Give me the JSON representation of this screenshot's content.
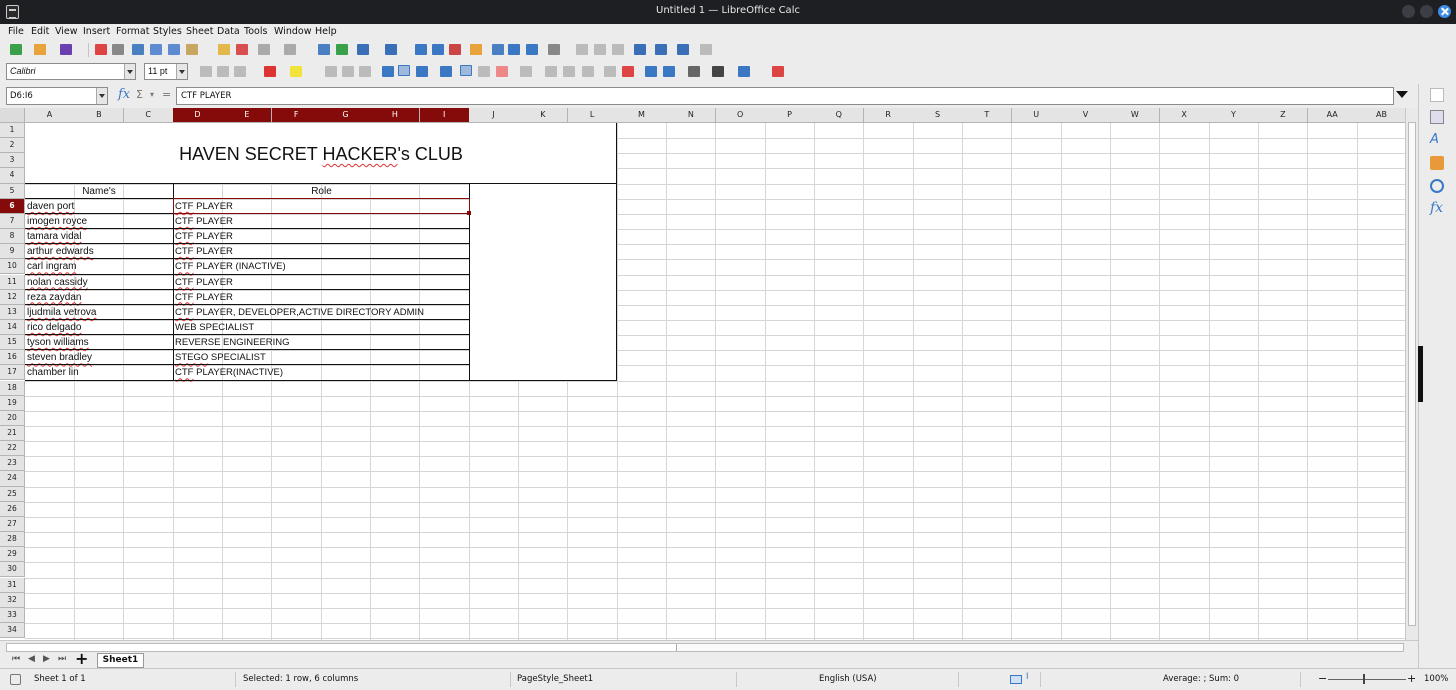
{
  "window": {
    "title": "Untitled 1 — LibreOffice Calc"
  },
  "menu": [
    "File",
    "Edit",
    "View",
    "Insert",
    "Format",
    "Styles",
    "Sheet",
    "Data",
    "Tools",
    "Window",
    "Help"
  ],
  "toolbar": {
    "font_name": "Calibri",
    "font_size": "11 pt"
  },
  "formula_bar": {
    "cell_ref": "D6:I6",
    "content": "CTF PLAYER",
    "function_wizard_icon": "fx",
    "sum_icon": "Σ",
    "equals_icon": "="
  },
  "columns": [
    "A",
    "B",
    "C",
    "D",
    "E",
    "F",
    "G",
    "H",
    "I",
    "J",
    "K",
    "L",
    "M",
    "N",
    "O",
    "P",
    "Q",
    "R",
    "S",
    "T",
    "U",
    "V",
    "W",
    "X",
    "Y",
    "Z",
    "AA",
    "AB"
  ],
  "selected_columns": [
    "D",
    "E",
    "F",
    "G",
    "H",
    "I"
  ],
  "rows": [
    "1",
    "2",
    "3",
    "4",
    "5",
    "6",
    "7",
    "8",
    "9",
    "10",
    "11",
    "12",
    "13",
    "14",
    "15",
    "16",
    "17",
    "18",
    "19",
    "20",
    "21",
    "22",
    "23",
    "24",
    "25",
    "26",
    "27",
    "28",
    "29",
    "30",
    "31",
    "32",
    "33",
    "34"
  ],
  "selected_row": "6",
  "sheet": {
    "title_prefix": "HAVEN SECRET ",
    "title_misspelled": "HACKER",
    "title_suffix": "'s CLUB",
    "header_names": "Name's",
    "header_role": "Role",
    "members": [
      {
        "name": "daven port",
        "role_prefix": "CTF",
        "role_rest": " PLAYER"
      },
      {
        "name": "imogen royce",
        "role_prefix": "CTF",
        "role_rest": " PLAYER"
      },
      {
        "name": "tamara vidal",
        "role_prefix": "CTF",
        "role_rest": " PLAYER"
      },
      {
        "name": "arthur edwards",
        "role_prefix": "CTF",
        "role_rest": " PLAYER"
      },
      {
        "name": "carl ingram",
        "role_prefix": "CTF",
        "role_rest": " PLAYER (INACTIVE)"
      },
      {
        "name": "nolan cassidy",
        "role_prefix": "CTF",
        "role_rest": " PLAYER"
      },
      {
        "name": "reza zaydan",
        "role_prefix": "CTF",
        "role_rest": " PLAYER"
      },
      {
        "name": "ljudmila vetrova",
        "role_prefix": "CTF",
        "role_rest": " PLAYER, DEVELOPER,ACTIVE DIRECTORY ADMIN"
      },
      {
        "name": "rico delgado",
        "role_prefix": "",
        "role_rest": "WEB SPECIALIST"
      },
      {
        "name": "tyson williams",
        "role_prefix": "",
        "role_rest": "REVERSE ENGINEERING"
      },
      {
        "name": "steven bradley",
        "role_prefix": "STEGO",
        "role_rest": " SPECIALIST"
      },
      {
        "name": "chamber lin",
        "role_prefix": "CTF",
        "role_rest": " PLAYER(INACTIVE)"
      }
    ]
  },
  "tabs": {
    "active": "Sheet1"
  },
  "status": {
    "sheet": "Sheet 1 of 1",
    "selection": "Selected: 1 row, 6 columns",
    "page_style": "PageStyle_Sheet1",
    "language": "English (USA)",
    "summary": "Average: ; Sum: 0",
    "zoom": "100%"
  },
  "colors": {
    "selection": "#850a0a",
    "accent": "#3a78c4",
    "spellcheck": "#dd3333"
  }
}
